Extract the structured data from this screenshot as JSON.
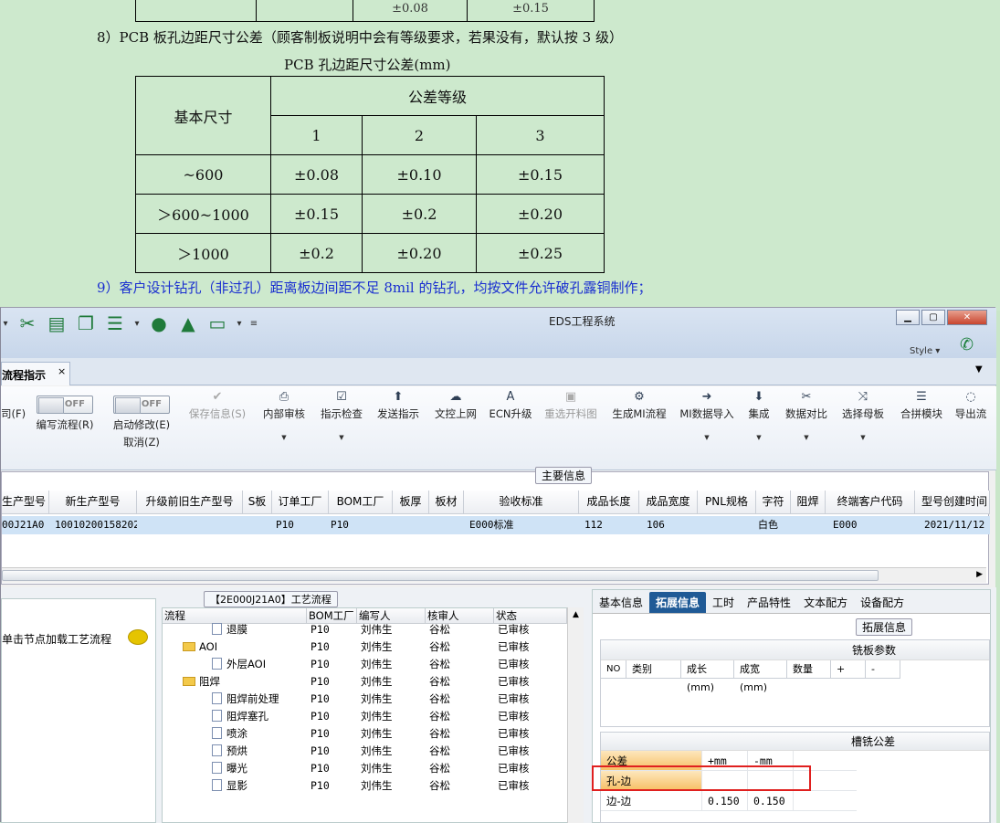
{
  "document": {
    "top_table_cells": [
      "",
      "",
      "±0.08",
      "±0.15"
    ],
    "line8": "8）PCB 板孔边距尺寸公差（顾客制板说明中会有等级要求，若果没有，默认按 3 级）",
    "caption": "PCB 孔边距尺寸公差(mm)",
    "table": {
      "col_header": "基本尺寸",
      "grade_header": "公差等级",
      "grades": [
        "1",
        "2",
        "3"
      ],
      "rows": [
        {
          "size": "~600",
          "v": [
            "±0.08",
            "±0.10",
            "±0.15"
          ]
        },
        {
          "size": "＞600~1000",
          "v": [
            "±0.15",
            "±0.2",
            "±0.20"
          ]
        },
        {
          "size": "＞1000",
          "v": [
            "±0.2",
            "±0.20",
            "±0.25"
          ]
        }
      ]
    },
    "line9": "9）客户设计钻孔（非过孔）距离板边间距不足 8mil 的钻孔，均按文件允许破孔露铜制作；"
  },
  "app": {
    "title": "EDS工程系统",
    "style_label": "Style",
    "tab": "流程指示",
    "tab_close": "×",
    "ribbon": [
      {
        "label": "司(F)",
        "icon": ""
      },
      {
        "label": "编写流程(R)",
        "toggle": "OFF"
      },
      {
        "label": "启动修改(E)",
        "sub": "取消(Z)",
        "toggle": "OFF"
      },
      {
        "label": "保存信息(S)",
        "icon": "✔",
        "disabled": true
      },
      {
        "label": "内部审核",
        "icon": "⎙",
        "dd": true
      },
      {
        "label": "指示检查",
        "icon": "☑",
        "dd": true
      },
      {
        "label": "发送指示",
        "icon": "⬆"
      },
      {
        "label": "文控上网",
        "icon": "☁"
      },
      {
        "label": "ECN升级",
        "icon": "A"
      },
      {
        "label": "重选开料图",
        "icon": "▣",
        "disabled": true
      },
      {
        "label": "生成MI流程",
        "icon": "⚙"
      },
      {
        "label": "MI数据导入",
        "icon": "➜",
        "dd": true
      },
      {
        "label": "集成",
        "icon": "⬇",
        "dd": true
      },
      {
        "label": "数据对比",
        "icon": "✂",
        "dd": true
      },
      {
        "label": "选择母板",
        "icon": "⤨",
        "dd": true
      },
      {
        "label": "合拼模块",
        "icon": "☰"
      },
      {
        "label": "导出流",
        "icon": "◌"
      }
    ],
    "main_group_label": "主要信息",
    "grid": {
      "columns": [
        "生产型号",
        "新生产型号",
        "升级前旧生产型号",
        "S板",
        "订单工厂",
        "BOM工厂",
        "板厚",
        "板材",
        "验收标准",
        "成品长度",
        "成品宽度",
        "PNL规格",
        "字符",
        "阻焊",
        "终端客户代码",
        "型号创建时间"
      ],
      "row": [
        "00J21A0",
        "10010200158202",
        "",
        "",
        "P10",
        "P10",
        "",
        "",
        "E000标准",
        "112",
        "106",
        "",
        "白色",
        "",
        "E000",
        "2021/11/12"
      ]
    },
    "left_hint": "单击节点加载工艺流程",
    "process_label": "【2E000J21A0】工艺流程",
    "tree": {
      "headers": [
        "流程",
        "BOM工厂",
        "编写人",
        "核审人",
        "状态"
      ],
      "rows": [
        {
          "name": "退膜",
          "indent": 2,
          "folder": false,
          "bom": "P10",
          "writer": "刘伟生",
          "checker": "谷松",
          "status": "已审核"
        },
        {
          "name": "AOI",
          "indent": 1,
          "folder": true,
          "bom": "P10",
          "writer": "刘伟生",
          "checker": "谷松",
          "status": "已审核"
        },
        {
          "name": "外层AOI",
          "indent": 2,
          "folder": false,
          "bom": "P10",
          "writer": "刘伟生",
          "checker": "谷松",
          "status": "已审核"
        },
        {
          "name": "阻焊",
          "indent": 1,
          "folder": true,
          "bom": "P10",
          "writer": "刘伟生",
          "checker": "谷松",
          "status": "已审核"
        },
        {
          "name": "阻焊前处理",
          "indent": 2,
          "folder": false,
          "bom": "P10",
          "writer": "刘伟生",
          "checker": "谷松",
          "status": "已审核"
        },
        {
          "name": "阻焊塞孔",
          "indent": 2,
          "folder": false,
          "bom": "P10",
          "writer": "刘伟生",
          "checker": "谷松",
          "status": "已审核"
        },
        {
          "name": "喷涂",
          "indent": 2,
          "folder": false,
          "bom": "P10",
          "writer": "刘伟生",
          "checker": "谷松",
          "status": "已审核"
        },
        {
          "name": "预烘",
          "indent": 2,
          "folder": false,
          "bom": "P10",
          "writer": "刘伟生",
          "checker": "谷松",
          "status": "已审核"
        },
        {
          "name": "曝光",
          "indent": 2,
          "folder": false,
          "bom": "P10",
          "writer": "刘伟生",
          "checker": "谷松",
          "status": "已审核"
        },
        {
          "name": "显影",
          "indent": 2,
          "folder": false,
          "bom": "P10",
          "writer": "刘伟生",
          "checker": "谷松",
          "status": "已审核"
        }
      ]
    },
    "right_tabs": [
      "基本信息",
      "拓展信息",
      "工时",
      "产品特性",
      "文本配方",
      "设备配方"
    ],
    "right_active": "拓展信息",
    "ext_label": "拓展信息",
    "milling": {
      "title": "铣板参数",
      "headers": [
        "NO",
        "类别",
        "成长(mm)",
        "成宽(mm)",
        "数量",
        "+",
        "-"
      ]
    },
    "slot": {
      "title": "槽铣公差",
      "header": [
        "公差",
        "+mm",
        "-mm"
      ],
      "rows": [
        {
          "name": "孔-边",
          "plus": "",
          "minus": ""
        },
        {
          "name": "边-边",
          "plus": "0.150",
          "minus": "0.150"
        }
      ]
    },
    "colors": {
      "doc_bg": "#cde9cd",
      "highlight_row": "#cfe3f6",
      "active_tab": "#1f5a96",
      "annotation": "#e0201f"
    }
  }
}
